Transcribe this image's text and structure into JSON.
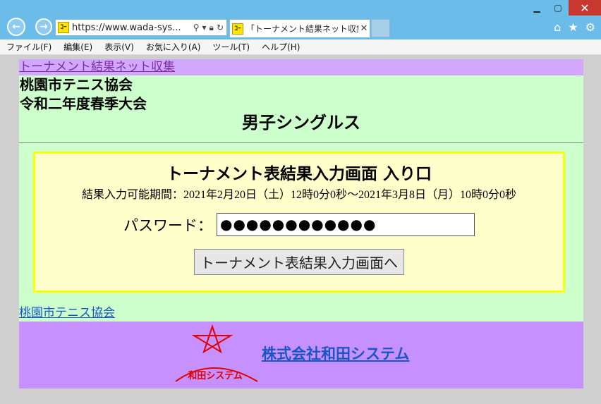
{
  "browser": {
    "url": "https://www.wada-sys...",
    "tab_title": "「トーナメント結果ネット収集」...",
    "menu": [
      "ファイル(F)",
      "編集(E)",
      "表示(V)",
      "お気に入り(A)",
      "ツール(T)",
      "ヘルプ(H)"
    ]
  },
  "page": {
    "top_link": "トーナメント結果ネット収集",
    "org": "桃園市テニス協会",
    "tournament": "令和二年度春季大会",
    "event": "男子シングルス",
    "entry_title": "トーナメント表結果入力画面 入り口",
    "period": "結果入力可能期間：2021年2月20日（土）12時0分0秒～2021年3月8日（月）10時0分0秒",
    "password_label": "パスワード：",
    "password_value": "●●●●●●●●●●●●",
    "submit_label": "トーナメント表結果入力画面へ",
    "assoc_link": "桃園市テニス協会",
    "logo_text": "和田システム",
    "company_link": "株式会社和田システム"
  },
  "colors": {
    "header_purple": "#d4a7ff",
    "body_green": "#ccffcc",
    "box_yellow": "#ffffcc",
    "footer_purple": "#c691ff",
    "logo_red": "#e00000"
  }
}
